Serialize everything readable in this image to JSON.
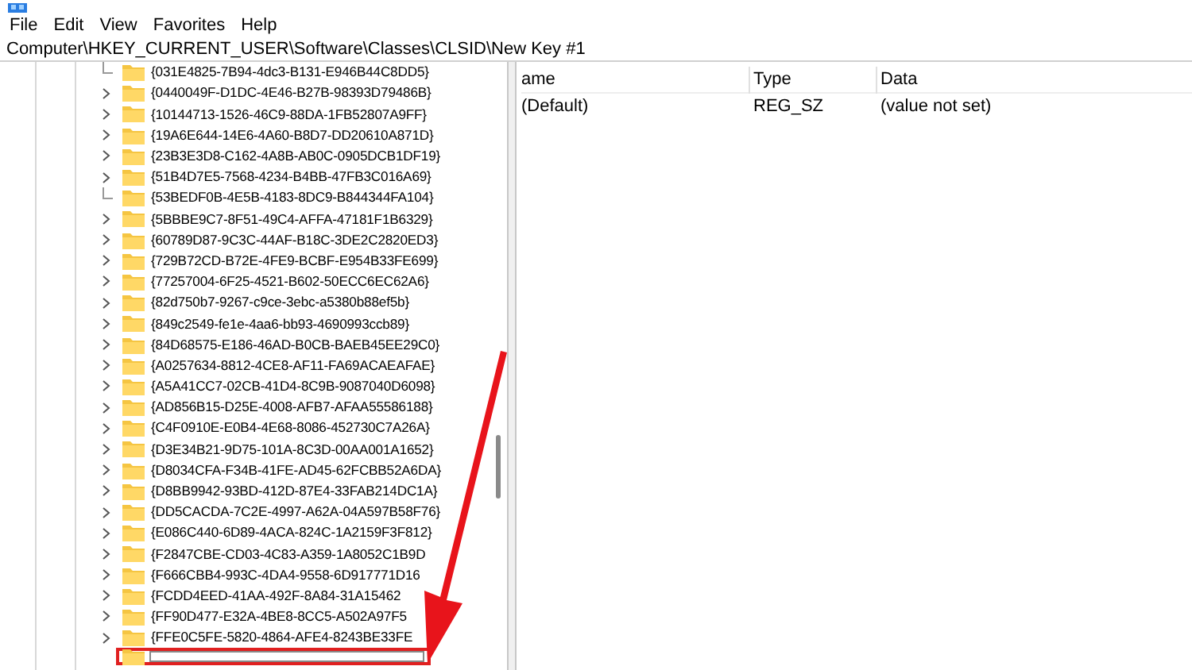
{
  "menu": [
    "File",
    "Edit",
    "View",
    "Favorites",
    "Help"
  ],
  "address": "Computer\\HKEY_CURRENT_USER\\Software\\Classes\\CLSID\\New Key #1",
  "tree": {
    "items": [
      {
        "label": "{031E4825-7B94-4dc3-B131-E946B44C8DD5}",
        "expandable": false
      },
      {
        "label": "{0440049F-D1DC-4E46-B27B-98393D79486B}",
        "expandable": true
      },
      {
        "label": "{10144713-1526-46C9-88DA-1FB52807A9FF}",
        "expandable": true
      },
      {
        "label": "{19A6E644-14E6-4A60-B8D7-DD20610A871D}",
        "expandable": true
      },
      {
        "label": "{23B3E3D8-C162-4A8B-AB0C-0905DCB1DF19}",
        "expandable": true
      },
      {
        "label": "{51B4D7E5-7568-4234-B4BB-47FB3C016A69}",
        "expandable": true
      },
      {
        "label": "{53BEDF0B-4E5B-4183-8DC9-B844344FA104}",
        "expandable": false
      },
      {
        "label": "{5BBBE9C7-8F51-49C4-AFFA-47181F1B6329}",
        "expandable": true
      },
      {
        "label": "{60789D87-9C3C-44AF-B18C-3DE2C2820ED3}",
        "expandable": true
      },
      {
        "label": "{729B72CD-B72E-4FE9-BCBF-E954B33FE699}",
        "expandable": true
      },
      {
        "label": "{77257004-6F25-4521-B602-50ECC6EC62A6}",
        "expandable": true
      },
      {
        "label": "{82d750b7-9267-c9ce-3ebc-a5380b88ef5b}",
        "expandable": true
      },
      {
        "label": "{849c2549-fe1e-4aa6-bb93-4690993ccb89}",
        "expandable": true
      },
      {
        "label": "{84D68575-E186-46AD-B0CB-BAEB45EE29C0}",
        "expandable": true
      },
      {
        "label": "{A0257634-8812-4CE8-AF11-FA69ACAEAFAE}",
        "expandable": true
      },
      {
        "label": "{A5A41CC7-02CB-41D4-8C9B-9087040D6098}",
        "expandable": true
      },
      {
        "label": "{AD856B15-D25E-4008-AFB7-AFAA55586188}",
        "expandable": true
      },
      {
        "label": "{C4F0910E-E0B4-4E68-8086-452730C7A26A}",
        "expandable": true
      },
      {
        "label": "{D3E34B21-9D75-101A-8C3D-00AA001A1652}",
        "expandable": true
      },
      {
        "label": "{D8034CFA-F34B-41FE-AD45-62FCBB52A6DA}",
        "expandable": true
      },
      {
        "label": "{D8BB9942-93BD-412D-87E4-33FAB214DC1A}",
        "expandable": true
      },
      {
        "label": "{DD5CACDA-7C2E-4997-A62A-04A597B58F76}",
        "expandable": true
      },
      {
        "label": "{E086C440-6D89-4ACA-824C-1A2159F3F812}",
        "expandable": true
      },
      {
        "label": "{F2847CBE-CD03-4C83-A359-1A8052C1B9D",
        "expandable": true
      },
      {
        "label": "{F666CBB4-993C-4DA4-9558-6D917771D16",
        "expandable": true
      },
      {
        "label": "{FCDD4EED-41AA-492F-8A84-31A15462",
        "expandable": true
      },
      {
        "label": "{FF90D477-E32A-4BE8-8CC5-A502A97F5",
        "expandable": true
      },
      {
        "label": "{FFE0C5FE-5820-4864-AFE4-8243BE33FE",
        "expandable": true
      }
    ],
    "new_key": {
      "editing": true
    }
  },
  "values": {
    "columns": [
      "ame",
      "Type",
      "Data"
    ],
    "rows": [
      {
        "name": "(Default)",
        "type": "REG_SZ",
        "data": "(value not set)"
      }
    ]
  }
}
